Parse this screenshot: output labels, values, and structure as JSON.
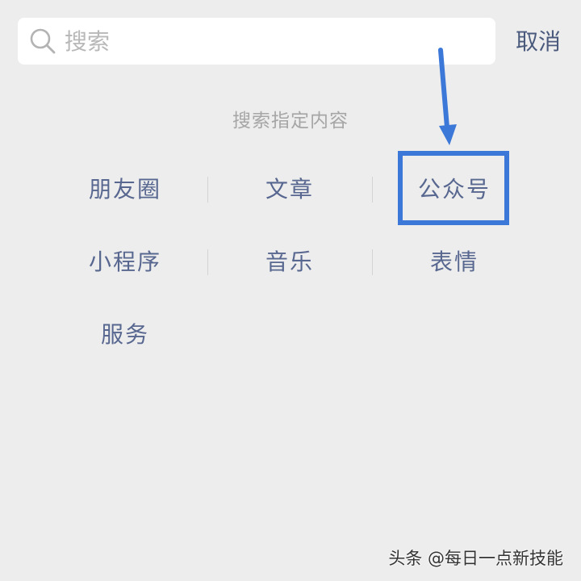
{
  "search": {
    "placeholder": "搜索",
    "value": "",
    "icon": "search-icon"
  },
  "header": {
    "cancel_label": "取消"
  },
  "section": {
    "title": "搜索指定内容"
  },
  "categories": [
    {
      "label": "朋友圈"
    },
    {
      "label": "文章"
    },
    {
      "label": "公众号",
      "highlighted": true
    },
    {
      "label": "小程序"
    },
    {
      "label": "音乐"
    },
    {
      "label": "表情"
    },
    {
      "label": "服务"
    }
  ],
  "annotation": {
    "color": "#3c78d8",
    "target": "公众号"
  },
  "watermark": {
    "text": "头条 @每日一点新技能"
  },
  "colors": {
    "background": "#ededed",
    "link_text": "#586790",
    "cancel_text": "#4a5a7d",
    "hint_text": "#a6a6a6"
  }
}
